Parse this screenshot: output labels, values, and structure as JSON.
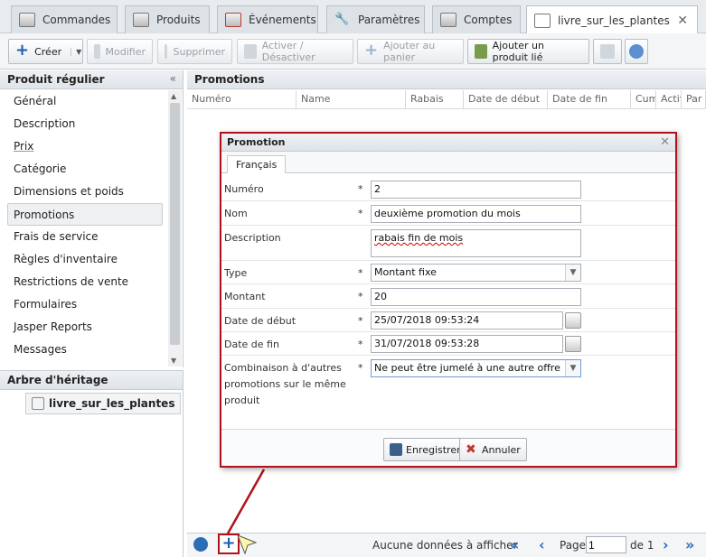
{
  "tabs": [
    {
      "label": "Commandes"
    },
    {
      "label": "Produits"
    },
    {
      "label": "Événements"
    },
    {
      "label": "Paramètres"
    },
    {
      "label": "Comptes"
    },
    {
      "label": "livre_sur_les_plantes"
    }
  ],
  "toolbar": {
    "create": "Créer",
    "modify": "Modifier",
    "delete": "Supprimer",
    "toggle": "Activer / Désactiver",
    "add_cart": "Ajouter au panier",
    "add_linked": "Ajouter un produit lié"
  },
  "left": {
    "title": "Produit régulier",
    "items": [
      "Général",
      "Description",
      "Prix",
      "Catégorie",
      "Dimensions et poids",
      "Promotions",
      "Frais de service",
      "Règles d'inventaire",
      "Restrictions de vente",
      "Formulaires",
      "Jasper Reports",
      "Messages"
    ],
    "heritage_title": "Arbre d'héritage",
    "heritage_item": "livre_sur_les_plantes"
  },
  "main": {
    "title": "Promotions",
    "columns": [
      "Numéro",
      "Name",
      "Rabais",
      "Date de début",
      "Date de fin",
      "Cum",
      "Actif",
      "Par r"
    ],
    "pager": {
      "empty": "Aucune données à afficher",
      "page_label": "Page",
      "page_value": "1",
      "of_label": "de 1"
    }
  },
  "modal": {
    "title": "Promotion",
    "tab": "Français",
    "fields": {
      "numero_label": "Numéro",
      "numero_value": "2",
      "nom_label": "Nom",
      "nom_value": "deuxième promotion du mois",
      "desc_label": "Description",
      "desc_value": "rabais fin de  mois",
      "type_label": "Type",
      "type_value": "Montant fixe",
      "montant_label": "Montant",
      "montant_value": "20",
      "debut_label": "Date de début",
      "debut_value": "25/07/2018 09:53:24",
      "fin_label": "Date de fin",
      "fin_value": "31/07/2018 09:53:28",
      "combo_label": "Combinaison à d'autres promotions sur le même produit",
      "combo_value": "Ne peut être jumelé à une autre offre",
      "required": "*"
    },
    "save": "Enregistrer",
    "cancel": "Annuler"
  },
  "colors": {
    "accent": "#b0121b",
    "link_blue": "#2d6db5"
  }
}
